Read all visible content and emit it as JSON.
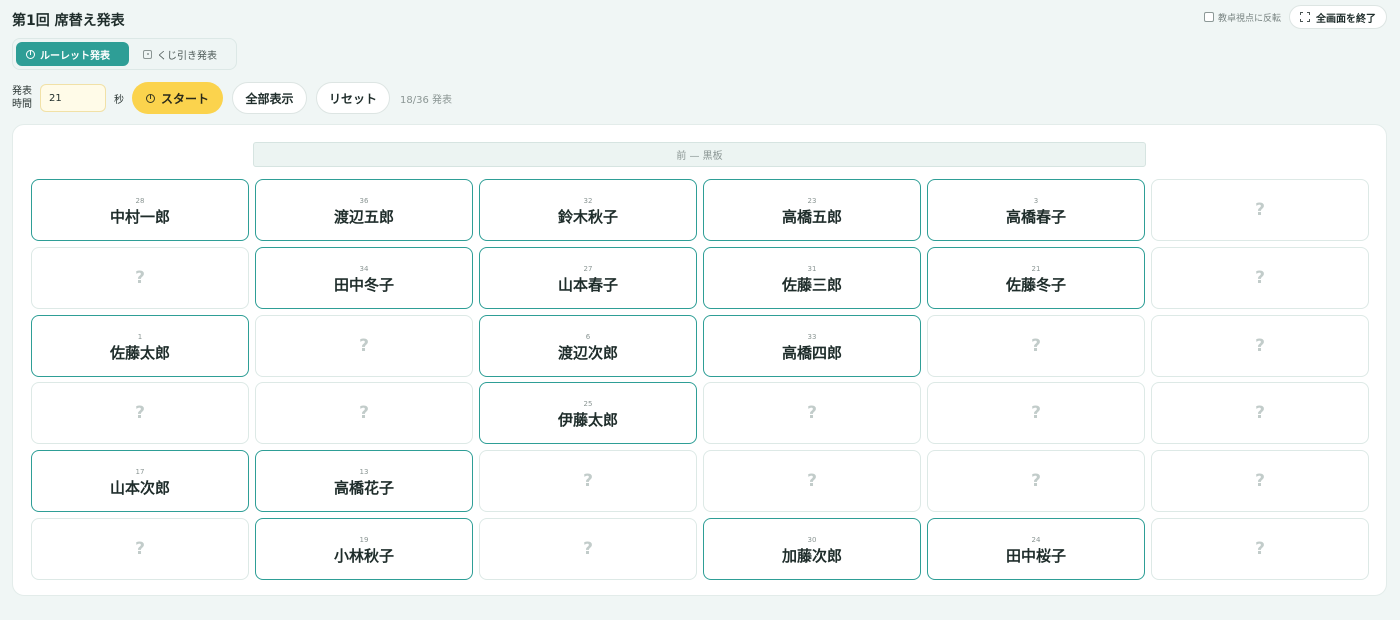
{
  "header": {
    "title": "第1回 席替え発表",
    "flip_label": "教卓視点に反転",
    "exit_fullscreen": "全画面を終了"
  },
  "mode_tabs": [
    {
      "label": "ルーレット発表",
      "active": true,
      "icon": "roulette-icon"
    },
    {
      "label": "くじ引き発表",
      "active": false,
      "icon": "dice-icon"
    }
  ],
  "controls": {
    "time_label_1": "発表",
    "time_label_2": "時間",
    "time_value": "21",
    "seconds_unit": "秒",
    "start": "スタート",
    "show_all": "全部表示",
    "reset": "リセット",
    "progress": "18/36 発表"
  },
  "board": {
    "blackboard": "前 — 黒板",
    "rows": [
      [
        {
          "num": "28",
          "name": "中村一郎"
        },
        {
          "num": "36",
          "name": "渡辺五郎"
        },
        {
          "num": "32",
          "name": "鈴木秋子"
        },
        {
          "num": "23",
          "name": "高橋五郎"
        },
        {
          "num": "3",
          "name": "高橋春子"
        },
        null
      ],
      [
        null,
        {
          "num": "34",
          "name": "田中冬子"
        },
        {
          "num": "27",
          "name": "山本春子"
        },
        {
          "num": "31",
          "name": "佐藤三郎"
        },
        {
          "num": "21",
          "name": "佐藤冬子"
        },
        null
      ],
      [
        {
          "num": "1",
          "name": "佐藤太郎"
        },
        null,
        {
          "num": "6",
          "name": "渡辺次郎"
        },
        {
          "num": "33",
          "name": "高橋四郎"
        },
        null,
        null
      ],
      [
        null,
        null,
        {
          "num": "25",
          "name": "伊藤太郎"
        },
        null,
        null,
        null
      ],
      [
        {
          "num": "17",
          "name": "山本次郎"
        },
        {
          "num": "13",
          "name": "高橋花子"
        },
        null,
        null,
        null,
        null
      ],
      [
        null,
        {
          "num": "19",
          "name": "小林秋子"
        },
        null,
        {
          "num": "30",
          "name": "加藤次郎"
        },
        {
          "num": "24",
          "name": "田中桜子"
        },
        null
      ]
    ],
    "hidden_mark": "?"
  },
  "colors": {
    "accent": "#2e9e96",
    "start_button": "#fbd34d",
    "background": "#f0f6f5"
  }
}
